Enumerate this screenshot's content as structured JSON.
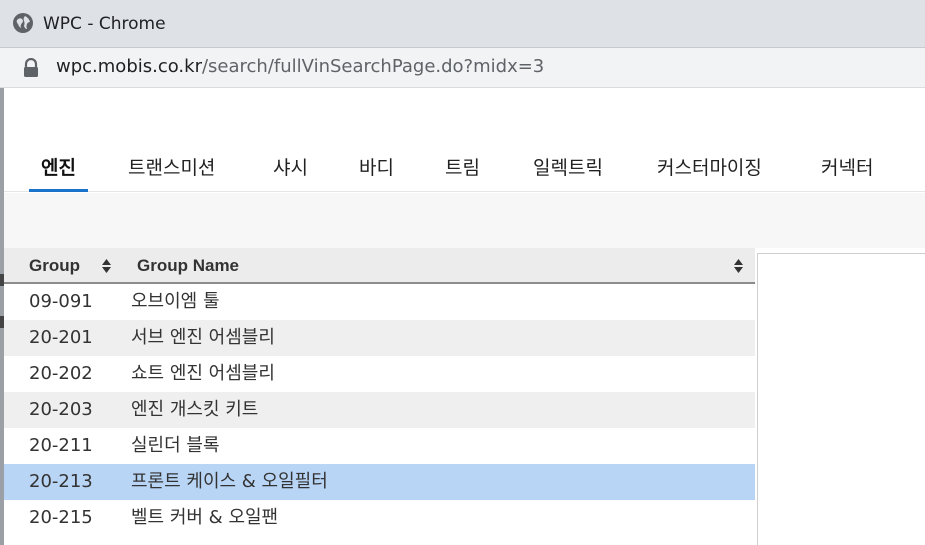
{
  "window": {
    "title": "WPC - Chrome"
  },
  "address": {
    "host": "wpc.mobis.co.kr",
    "path": "/search/fullVinSearchPage.do?midx=3"
  },
  "tabs": [
    {
      "label": "엔진",
      "active": true
    },
    {
      "label": "트랜스미션",
      "active": false
    },
    {
      "label": "샤시",
      "active": false
    },
    {
      "label": "바디",
      "active": false
    },
    {
      "label": "트림",
      "active": false
    },
    {
      "label": "일렉트릭",
      "active": false
    },
    {
      "label": "커스터마이징",
      "active": false
    },
    {
      "label": "커넥터",
      "active": false
    }
  ],
  "table": {
    "columns": [
      "Group",
      "Group Name"
    ],
    "rows": [
      {
        "group": "09-091",
        "name": "오브이엠 툴"
      },
      {
        "group": "20-201",
        "name": "서브 엔진 어셈블리"
      },
      {
        "group": "20-202",
        "name": "쇼트 엔진 어셈블리"
      },
      {
        "group": "20-203",
        "name": "엔진 개스킷 키트"
      },
      {
        "group": "20-211",
        "name": "실린더 블록"
      },
      {
        "group": "20-213",
        "name": "프론트 케이스 & 오일필터",
        "selected": true
      },
      {
        "group": "20-215",
        "name": "벨트 커버 & 오일팬"
      }
    ]
  },
  "colors": {
    "accent": "#1a73c8",
    "selected_row": "#b9d5f6",
    "alt_row": "#efefef"
  }
}
